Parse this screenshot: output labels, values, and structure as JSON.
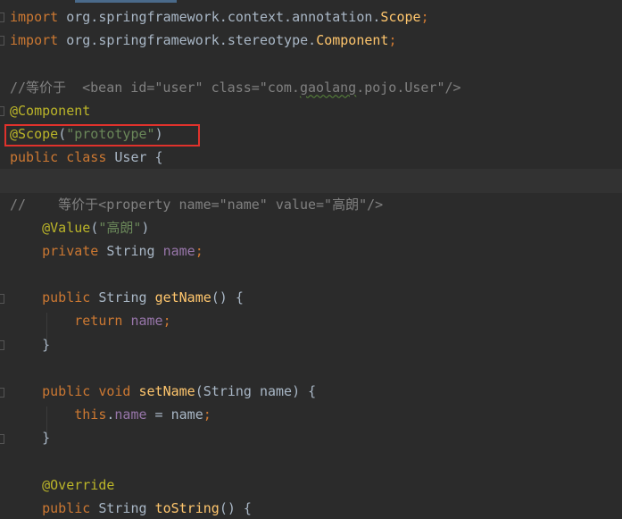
{
  "code": {
    "l1": {
      "t1": "import ",
      "t2": "org.springframework.context.annotation.",
      "t3": "Scope",
      "t4": ";"
    },
    "l2": {
      "t1": "import ",
      "t2": "org.springframework.stereotype.",
      "t3": "Component",
      "t4": ";"
    },
    "l4": {
      "t1": "//等价于  <bean id=\"user\" class=\"com.",
      "t2": "gaolang",
      "t3": ".pojo.User\"/>"
    },
    "l5": {
      "t1": "@Component"
    },
    "l6": {
      "t1": "@Scope",
      "t2": "(",
      "t3": "\"prototype\"",
      "t4": ")"
    },
    "l7": {
      "t1": "public class ",
      "t2": "User {"
    },
    "l9": {
      "t1": "//    等价于<property name=\"name\" value=\"高朗\"/>"
    },
    "l10": {
      "t1": "    @Value",
      "t2": "(",
      "t3": "\"高朗\"",
      "t4": ")"
    },
    "l11": {
      "t1": "    private ",
      "t2": "String ",
      "t3": "name",
      "t4": ";"
    },
    "l13": {
      "t1": "    public ",
      "t2": "String ",
      "t3": "getName",
      "t4": "() {"
    },
    "l14": {
      "t1": "        return ",
      "t2": "name",
      "t3": ";"
    },
    "l15": {
      "t1": "    }"
    },
    "l17": {
      "t1": "    public void ",
      "t2": "setName",
      "t3": "(String name) {"
    },
    "l18": {
      "t1": "        this",
      "t2": ".",
      "t3": "name",
      "t4": " = name",
      "t5": ";"
    },
    "l19": {
      "t1": "    }"
    },
    "l21": {
      "t1": "    @Override"
    },
    "l22": {
      "t1": "    public ",
      "t2": "String ",
      "t3": "toString",
      "t4": "() {"
    }
  },
  "colors": {
    "background": "#2b2b2b",
    "keyword": "#cc7832",
    "annotation": "#bbb529",
    "string": "#6a8759",
    "comment": "#808080",
    "field": "#9876aa",
    "method": "#ffc66d",
    "highlight_box": "#e0322c"
  }
}
